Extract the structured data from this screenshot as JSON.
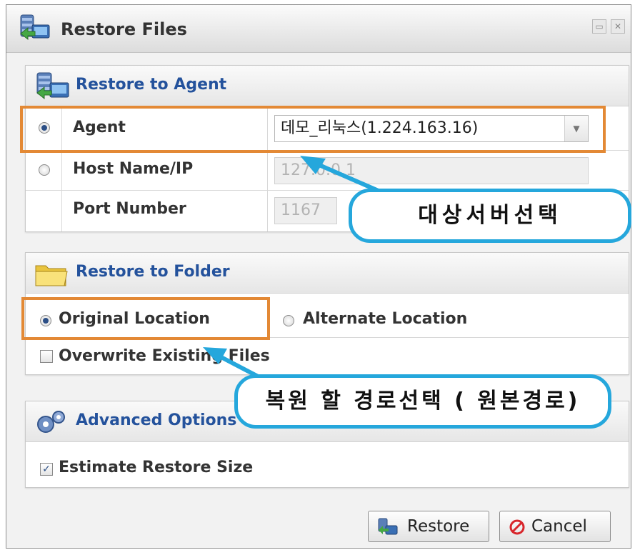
{
  "window": {
    "title": "Restore Files",
    "buttons": [
      "restore-window",
      "close-window"
    ]
  },
  "restore_to_agent": {
    "title": "Restore to Agent",
    "agent_label": "Agent",
    "agent_selected": true,
    "agent_value": "데모_리눅스(1.224.163.16)",
    "host_label": "Host Name/IP",
    "host_selected": false,
    "host_value": "127.0.0.1",
    "port_label": "Port Number",
    "port_value": "1167"
  },
  "restore_to_folder": {
    "title": "Restore to Folder",
    "original_label": "Original Location",
    "original_selected": true,
    "alternate_label": "Alternate Location",
    "alternate_selected": false,
    "overwrite_label": "Overwrite Existing Files",
    "overwrite_checked": false
  },
  "advanced_options": {
    "title": "Advanced Options",
    "estimate_label": "Estimate Restore Size",
    "estimate_checked": true
  },
  "annotations": {
    "callout_server": "대상서버선택",
    "callout_path": "복원 할 경로선택 ( 원본경로)"
  },
  "footer": {
    "restore_label": "Restore",
    "cancel_label": "Cancel"
  },
  "colors": {
    "accent_title": "#24529c",
    "highlight_box": "#e38935",
    "callout_border": "#25a7dc",
    "cancel_icon": "#d8262c"
  }
}
